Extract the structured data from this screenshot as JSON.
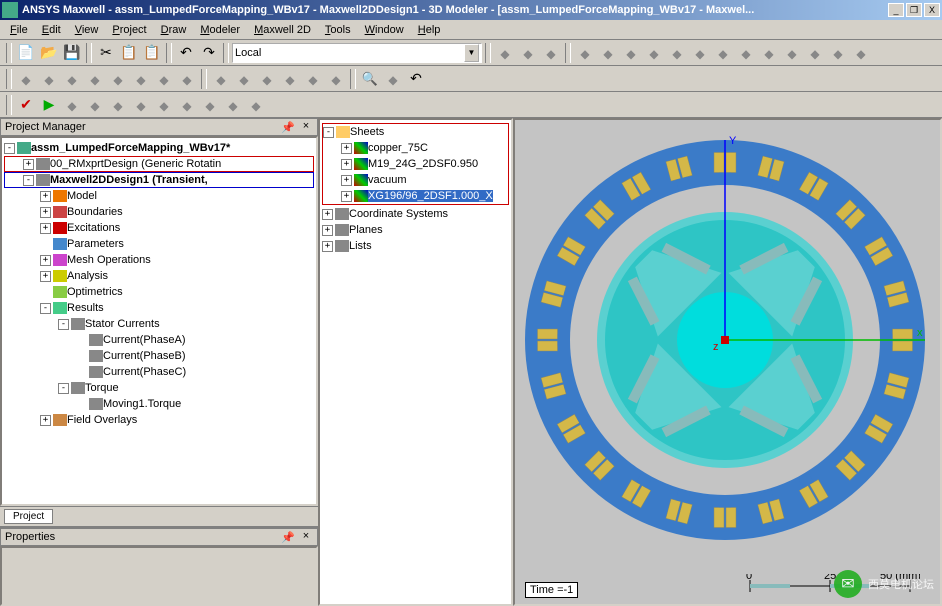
{
  "titlebar": {
    "app": "ANSYS Maxwell",
    "doc": "assm_LumpedForceMapping_WBv17",
    "design": "Maxwell2DDesign1",
    "view": "3D Modeler",
    "subdoc": "[assm_LumpedForceMapping_WBv17 - Maxwel...",
    "full": "ANSYS Maxwell - assm_LumpedForceMapping_WBv17 - Maxwell2DDesign1 - 3D Modeler - [assm_LumpedForceMapping_WBv17 - Maxwel..."
  },
  "menu": [
    "File",
    "Edit",
    "View",
    "Project",
    "Draw",
    "Modeler",
    "Maxwell 2D",
    "Tools",
    "Window",
    "Help"
  ],
  "toolbar": {
    "coord_system": "Local"
  },
  "project_manager": {
    "title": "Project Manager",
    "root": "assm_LumpedForceMapping_WBv17*",
    "items": [
      {
        "label": "00_RMxprtDesign (Generic Rotatin",
        "boxed": "red",
        "indent": 1,
        "exp": "+"
      },
      {
        "label": "Maxwell2DDesign1 (Transient,",
        "boxed": "blue",
        "indent": 1,
        "exp": "-",
        "bold": true
      },
      {
        "label": "Model",
        "indent": 2,
        "exp": "+"
      },
      {
        "label": "Boundaries",
        "indent": 2,
        "exp": "+"
      },
      {
        "label": "Excitations",
        "indent": 2,
        "exp": "+"
      },
      {
        "label": "Parameters",
        "indent": 2,
        "exp": ""
      },
      {
        "label": "Mesh Operations",
        "indent": 2,
        "exp": "+"
      },
      {
        "label": "Analysis",
        "indent": 2,
        "exp": "+"
      },
      {
        "label": "Optimetrics",
        "indent": 2,
        "exp": ""
      },
      {
        "label": "Results",
        "indent": 2,
        "exp": "-"
      },
      {
        "label": "Stator Currents",
        "indent": 3,
        "exp": "-"
      },
      {
        "label": "Current(PhaseA)",
        "indent": 4,
        "exp": ""
      },
      {
        "label": "Current(PhaseB)",
        "indent": 4,
        "exp": ""
      },
      {
        "label": "Current(PhaseC)",
        "indent": 4,
        "exp": ""
      },
      {
        "label": "Torque",
        "indent": 3,
        "exp": "-"
      },
      {
        "label": "Moving1.Torque",
        "indent": 4,
        "exp": ""
      },
      {
        "label": "Field Overlays",
        "indent": 2,
        "exp": "+"
      }
    ],
    "tab": "Project"
  },
  "properties": {
    "title": "Properties"
  },
  "model_tree": {
    "root": "Sheets",
    "items": [
      {
        "label": "copper_75C",
        "exp": "+"
      },
      {
        "label": "M19_24G_2DSF0.950",
        "exp": "+"
      },
      {
        "label": "vacuum",
        "exp": "+"
      },
      {
        "label": "XG196/96_2DSF1.000_X",
        "exp": "+",
        "hl": true
      }
    ],
    "extra": [
      {
        "label": "Coordinate Systems",
        "exp": "+"
      },
      {
        "label": "Planes",
        "exp": "+"
      },
      {
        "label": "Lists",
        "exp": "+"
      }
    ]
  },
  "viewport": {
    "time_label": "Time =-1",
    "ruler_ticks": [
      "0",
      "25",
      "50 (mm)"
    ],
    "axes": {
      "x": "x",
      "y": "Y",
      "z": "z"
    }
  },
  "watermark": "西莫电机论坛"
}
